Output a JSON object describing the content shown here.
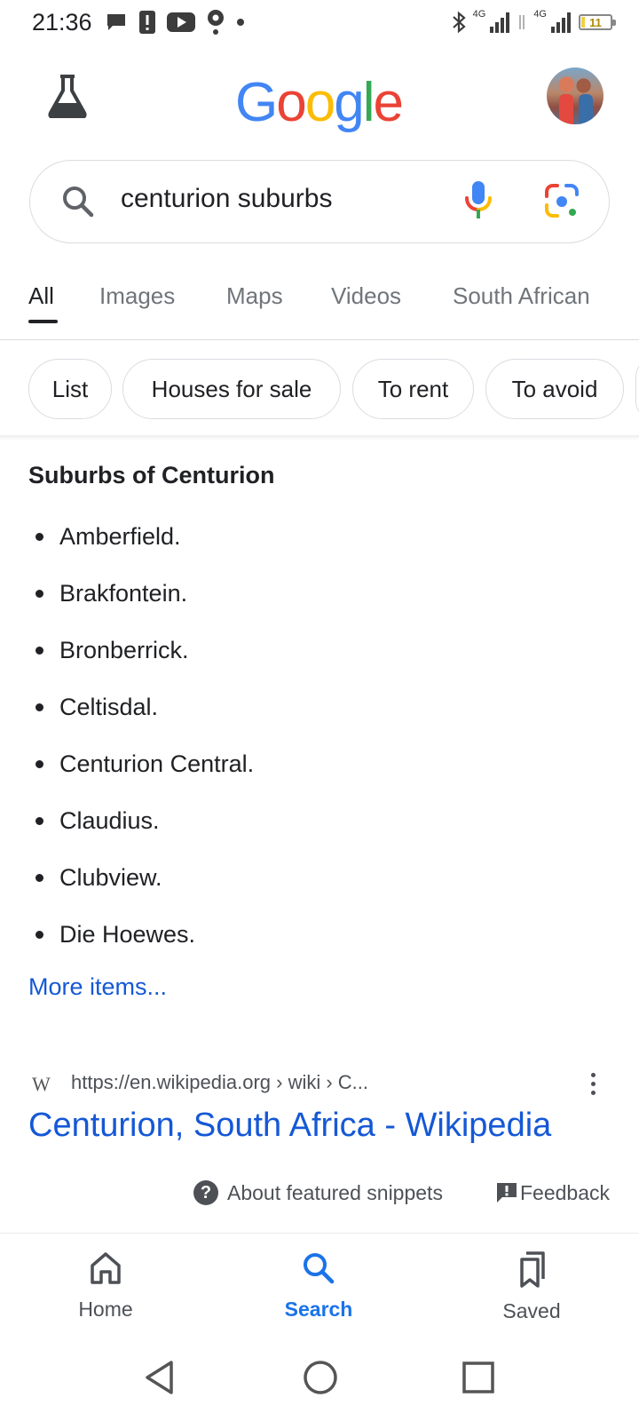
{
  "status_bar": {
    "time": "21:36",
    "left_icons": [
      "chat-bubble-icon",
      "alert-icon",
      "youtube-icon",
      "location-icon",
      "dot-icon"
    ],
    "network_1": "4G",
    "network_2": "4G",
    "battery_level": "11",
    "battery_fraction": 0.11
  },
  "header": {
    "logo_text": "Google",
    "logo_colors": [
      "#4285F4",
      "#EA4335",
      "#FBBC05",
      "#4285F4",
      "#34A853",
      "#EA4335"
    ]
  },
  "search": {
    "query": "centurion suburbs"
  },
  "tabs": [
    {
      "label": "All",
      "active": true
    },
    {
      "label": "Images",
      "active": false
    },
    {
      "label": "Maps",
      "active": false
    },
    {
      "label": "Videos",
      "active": false
    },
    {
      "label": "South African",
      "active": false
    }
  ],
  "chips": [
    {
      "label": "List"
    },
    {
      "label": "Houses for sale"
    },
    {
      "label": "To rent"
    },
    {
      "label": "To avoid"
    }
  ],
  "snippet": {
    "title": "Suburbs of Centurion",
    "items": [
      "Amberfield.",
      "Brakfontein.",
      "Bronberrick.",
      "Celtisdal.",
      "Centurion Central.",
      "Claudius.",
      "Clubview.",
      "Die Hoewes."
    ],
    "more_link": "More items..."
  },
  "result": {
    "favicon_letter": "W",
    "url": "https://en.wikipedia.org › wiki › C...",
    "title": "Centurion, South Africa - Wikipedia"
  },
  "footer_links": {
    "about": "About featured snippets",
    "feedback": "Feedback"
  },
  "bottom_nav": [
    {
      "label": "Home",
      "icon": "home-icon",
      "active": false
    },
    {
      "label": "Search",
      "icon": "search-icon",
      "active": true
    },
    {
      "label": "Saved",
      "icon": "bookmarks-icon",
      "active": false
    }
  ],
  "colors": {
    "link_blue": "#1558d6",
    "active_blue": "#1a73e8",
    "text_dark": "#202124",
    "text_gray": "#70757a"
  }
}
